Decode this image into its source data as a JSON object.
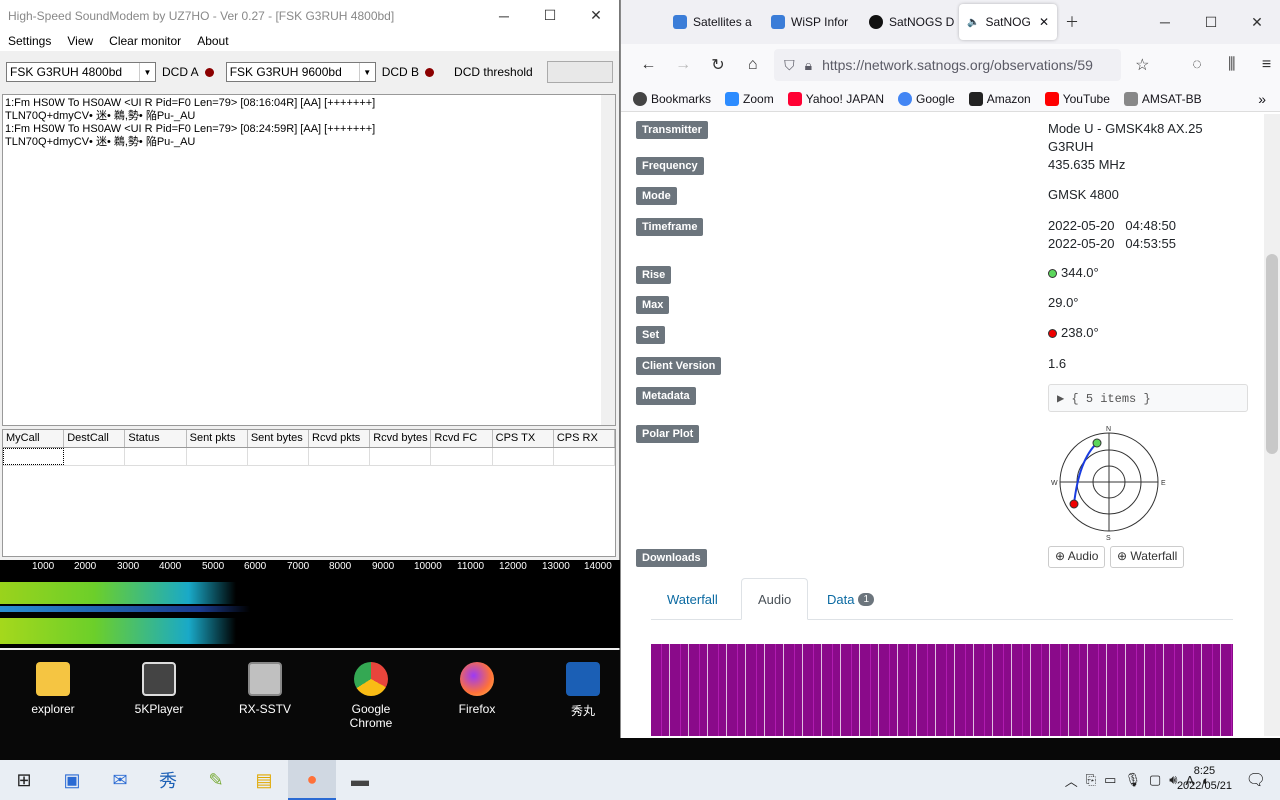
{
  "soundmodem": {
    "title": "High-Speed SoundModem by UZ7HO - Ver 0.27 - [FSK G3RUH 4800bd]",
    "menu": [
      "Settings",
      "View",
      "Clear monitor",
      "About"
    ],
    "modem_a": "FSK G3RUH 4800bd",
    "dcd_a": "DCD A",
    "modem_b": "FSK G3RUH 9600bd",
    "dcd_b": "DCD B",
    "dcd_threshold": "DCD threshold",
    "monitor_lines": [
      "1:Fm HS0W To HS0AW <UI R Pid=F0 Len=79> [08:16:04R] [AA] [+++++++]",
      "TLN70Q+dmyCV• 迷• 鵜,勢• 陥Pu-_AU",
      "1:Fm HS0W To HS0AW <UI R Pid=F0 Len=79> [08:24:59R] [AA] [+++++++]",
      "TLN70Q+dmyCV• 迷• 鵜,勢• 陥Pu-_AU"
    ],
    "grid_headers": [
      "MyCall",
      "DestCall",
      "Status",
      "Sent pkts",
      "Sent bytes",
      "Rcvd pkts",
      "Rcvd bytes",
      "Rcvd FC",
      "CPS TX",
      "CPS RX"
    ],
    "scale": [
      "1000",
      "2000",
      "3000",
      "4000",
      "5000",
      "6000",
      "7000",
      "8000",
      "9000",
      "10000",
      "11000",
      "12000",
      "13000",
      "14000"
    ]
  },
  "desktop": {
    "icons": [
      {
        "label": "explorer",
        "color": "#f5c542"
      },
      {
        "label": "5KPlayer",
        "color": "#d9d9d9"
      },
      {
        "label": "RX-SSTV",
        "color": "#c0c0c0"
      },
      {
        "label": "Google Chrome",
        "color": "#e8453c"
      },
      {
        "label": "Firefox",
        "color": "#ff7139"
      },
      {
        "label": "秀丸",
        "color": "#1b5fb5"
      }
    ]
  },
  "firefox": {
    "tabs": [
      {
        "label": "Satellites a",
        "color": "#3b7dd8"
      },
      {
        "label": "WiSP Infor",
        "color": "#3b7dd8"
      },
      {
        "label": "SatNOGS D",
        "color": "#111111"
      },
      {
        "label": "SatNOG",
        "color": "#555555"
      }
    ],
    "url": "https://network.satnogs.org/observations/59",
    "bookmarks": [
      {
        "label": "Bookmarks",
        "color": "#444444"
      },
      {
        "label": "Zoom",
        "color": "#2d8cff"
      },
      {
        "label": "Yahoo! JAPAN",
        "color": "#ff0033"
      },
      {
        "label": "Google",
        "color": "#4285f4"
      },
      {
        "label": "Amazon",
        "color": "#222222"
      },
      {
        "label": "YouTube",
        "color": "#ff0000"
      },
      {
        "label": "AMSAT-BB",
        "color": "#888888"
      }
    ],
    "fields": {
      "transmitter_label": "Transmitter",
      "transmitter_value": "Mode U - GMSK4k8 AX.25 G3RUH",
      "frequency_label": "Frequency",
      "frequency_value": "435.635 MHz",
      "mode_label": "Mode",
      "mode_value": "GMSK 4800",
      "timeframe_label": "Timeframe",
      "timeframe_start": "2022-05-20   04:48:50",
      "timeframe_end": "2022-05-20   04:53:55",
      "rise_label": "Rise",
      "rise_value": "344.0°",
      "max_label": "Max",
      "max_value": "29.0°",
      "set_label": "Set",
      "set_value": "238.0°",
      "client_label": "Client Version",
      "client_value": "1.6",
      "metadata_label": "Metadata",
      "metadata_value": "▶ {  5 items  }",
      "polar_label": "Polar Plot",
      "downloads_label": "Downloads",
      "audio_btn": "Audio",
      "waterfall_btn": "Waterfall"
    },
    "polar": {
      "n": "N",
      "s": "S",
      "e": "E",
      "w": "W"
    },
    "content_tabs": {
      "waterfall": "Waterfall",
      "audio": "Audio",
      "data": "Data",
      "data_count": "1"
    }
  },
  "taskbar": {
    "time": "8:25",
    "date": "2022/05/21",
    "ime": "A"
  }
}
